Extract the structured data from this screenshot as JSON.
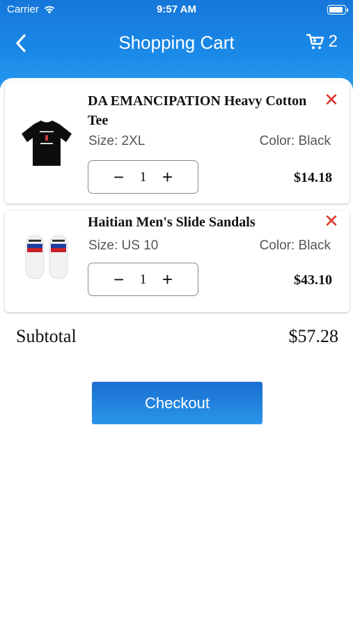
{
  "status_bar": {
    "carrier": "Carrier",
    "time": "9:57 AM"
  },
  "nav": {
    "title": "Shopping Cart",
    "cart_count": "2"
  },
  "items": [
    {
      "title": "DA EMANCIPATION   Heavy Cotton Tee",
      "size": "Size: 2XL",
      "color": "Color: Black",
      "quantity": "1",
      "price": "$14.18",
      "image": "black-t-shirt"
    },
    {
      "title": "Haitian Men's Slide Sandals",
      "size": "Size: US 10",
      "color": "Color: Black",
      "quantity": "1",
      "price": "$43.10",
      "image": "white-slide-sandals"
    }
  ],
  "subtotal": {
    "label": "Subtotal",
    "value": "$57.28"
  },
  "checkout": {
    "label": "Checkout"
  },
  "icons": {
    "remove": "close-icon",
    "minus": "minus-icon",
    "plus": "plus-icon",
    "back": "chevron-left-icon",
    "cart": "cart-icon"
  },
  "colors": {
    "header": "#1a7fe0",
    "remove": "#e0342c",
    "button": "#1f82e0"
  }
}
